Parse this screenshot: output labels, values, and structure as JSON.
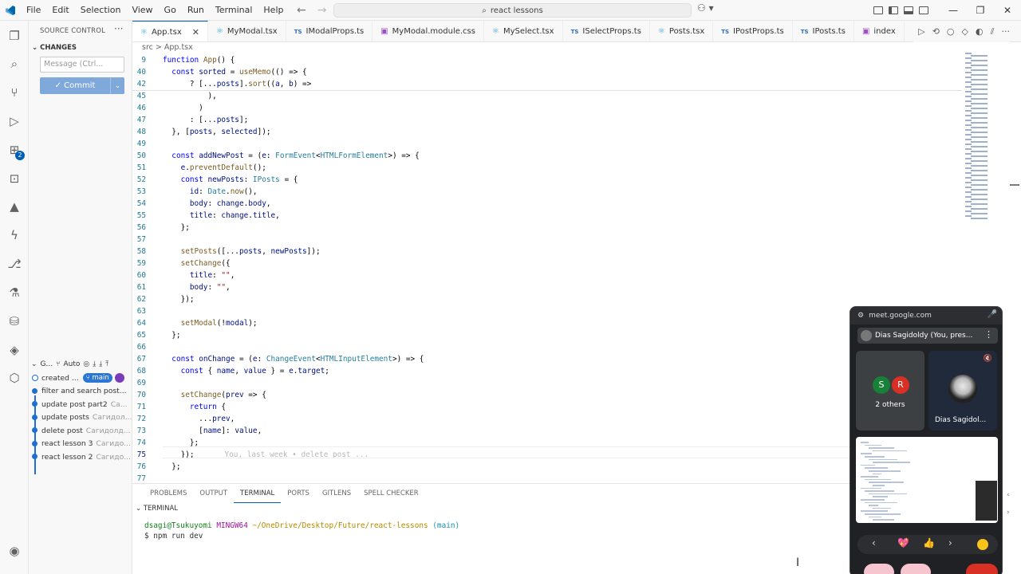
{
  "window": {
    "search_text": "react lessons",
    "menu": [
      "File",
      "Edit",
      "Selection",
      "View",
      "Go",
      "Run",
      "Terminal",
      "Help"
    ]
  },
  "sidebar": {
    "title": "SOURCE CONTROL",
    "changes_label": "CHANGES",
    "message_placeholder": "Message (Ctrl...",
    "commit_label": "Commit",
    "graph_title": "G...",
    "graph_auto": "Auto",
    "graph": [
      {
        "message": "created ...",
        "author": "",
        "branch": "main"
      },
      {
        "message": "filter and search post...",
        "author": ""
      },
      {
        "message": "update post part2",
        "author": "Ca..."
      },
      {
        "message": "update posts",
        "author": "Сагидол..."
      },
      {
        "message": "delete post",
        "author": "Сагидолд..."
      },
      {
        "message": "react lesson 3",
        "author": "Сагидо..."
      },
      {
        "message": "react lesson 2",
        "author": "Сагидо..."
      }
    ]
  },
  "tabs": [
    {
      "label": "App.tsx",
      "kind": "react",
      "active": true
    },
    {
      "label": "MyModal.tsx",
      "kind": "react"
    },
    {
      "label": "IModalProps.ts",
      "kind": "ts"
    },
    {
      "label": "MyModal.module.css",
      "kind": "css"
    },
    {
      "label": "MySelect.tsx",
      "kind": "react"
    },
    {
      "label": "ISelectProps.ts",
      "kind": "ts"
    },
    {
      "label": "Posts.tsx",
      "kind": "react"
    },
    {
      "label": "IPostProps.ts",
      "kind": "ts"
    },
    {
      "label": "IPosts.ts",
      "kind": "ts"
    },
    {
      "label": "index",
      "kind": "css"
    }
  ],
  "breadcrumb": "src > App.tsx",
  "code_lines": [
    {
      "n": "9",
      "text": "function App() {"
    },
    {
      "n": "40",
      "text": "  const sorted = useMemo(() => {"
    },
    {
      "n": "42",
      "text": "      ? [...posts].sort((a, b) =>"
    },
    {
      "n": "45",
      "text": "          ),"
    },
    {
      "n": "46",
      "text": "        )"
    },
    {
      "n": "47",
      "text": "      : [...posts];"
    },
    {
      "n": "48",
      "text": "  }, [posts, selected]);"
    },
    {
      "n": "49",
      "text": ""
    },
    {
      "n": "50",
      "text": "  const addNewPost = (e: FormEvent<HTMLFormElement>) => {"
    },
    {
      "n": "51",
      "text": "    e.preventDefault();"
    },
    {
      "n": "52",
      "text": "    const newPosts: IPosts = {"
    },
    {
      "n": "53",
      "text": "      id: Date.now(),"
    },
    {
      "n": "54",
      "text": "      body: change.body,"
    },
    {
      "n": "55",
      "text": "      title: change.title,"
    },
    {
      "n": "56",
      "text": "    };"
    },
    {
      "n": "57",
      "text": ""
    },
    {
      "n": "58",
      "text": "    setPosts([...posts, newPosts]);"
    },
    {
      "n": "59",
      "text": "    setChange({"
    },
    {
      "n": "60",
      "text": "      title: \"\","
    },
    {
      "n": "61",
      "text": "      body: \"\","
    },
    {
      "n": "62",
      "text": "    });"
    },
    {
      "n": "63",
      "text": ""
    },
    {
      "n": "64",
      "text": "    setModal(!modal);"
    },
    {
      "n": "65",
      "text": "  };"
    },
    {
      "n": "66",
      "text": ""
    },
    {
      "n": "67",
      "text": "  const onChange = (e: ChangeEvent<HTMLInputElement>) => {"
    },
    {
      "n": "68",
      "text": "    const { name, value } = e.target;"
    },
    {
      "n": "69",
      "text": ""
    },
    {
      "n": "70",
      "text": "    setChange(prev => {"
    },
    {
      "n": "71",
      "text": "      return {"
    },
    {
      "n": "72",
      "text": "        ...prev,"
    },
    {
      "n": "73",
      "text": "        [name]: value,"
    },
    {
      "n": "74",
      "text": "      };"
    },
    {
      "n": "75",
      "text": "    });",
      "current": true,
      "ghost": "You, last week • delete post ..."
    },
    {
      "n": "76",
      "text": "  };"
    },
    {
      "n": "77",
      "text": ""
    }
  ],
  "panel": {
    "tabs": [
      "PROBLEMS",
      "OUTPUT",
      "TERMINAL",
      "PORTS",
      "GITLENS",
      "SPELL CHECKER"
    ],
    "active_tab": "TERMINAL",
    "terminal_header": "TERMINAL",
    "prompt_user": "dsagi@Tsukuyomi",
    "prompt_env": "MINGW64",
    "prompt_path": "~/OneDrive/Desktop/Future/react-lessons",
    "prompt_branch": "(main)",
    "command": "$ npm run dev"
  },
  "meet": {
    "url": "meet.google.com",
    "presenter": "Dias Sagidoldy (You, pres...",
    "others_label": "2 others",
    "avatar_s": "S",
    "avatar_r": "R",
    "self_label": "Dias Sagidol...",
    "colors": {
      "bg": "#202124",
      "end_call": "#d93025",
      "s": "#188038",
      "r": "#d93025"
    }
  },
  "activity_badge": "2"
}
